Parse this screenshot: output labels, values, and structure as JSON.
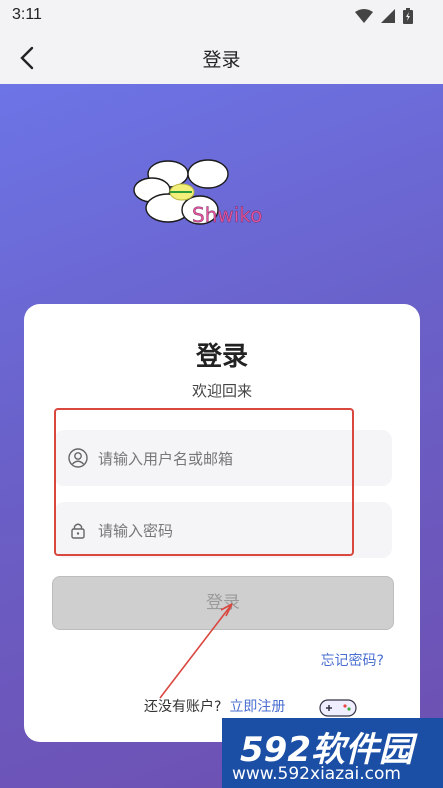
{
  "status": {
    "time": "3:11"
  },
  "appbar": {
    "title": "登录"
  },
  "logo": {
    "text": "Shwiko"
  },
  "card": {
    "title": "登录",
    "subtitle": "欢迎回来",
    "username_placeholder": "请输入用户名或邮箱",
    "password_placeholder": "请输入密码",
    "login_label": "登录",
    "forgot_label": "忘记密码?",
    "no_account_label": "还没有账户?",
    "register_label": "立即注册"
  },
  "watermark": {
    "brand": "592软件园",
    "url": "www.592xiazai.com"
  }
}
